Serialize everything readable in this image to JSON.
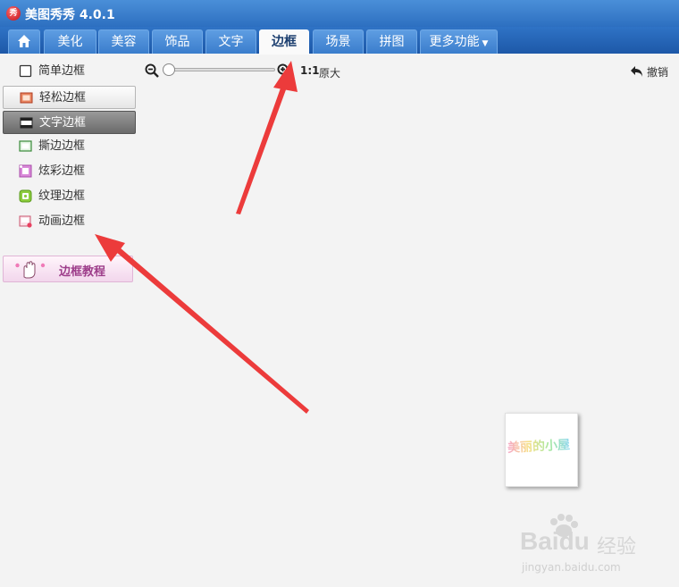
{
  "app": {
    "logo_text": "秀",
    "title": "美图秀秀 4.0.1"
  },
  "tabs": [
    {
      "label": "美化"
    },
    {
      "label": "美容"
    },
    {
      "label": "饰品"
    },
    {
      "label": "文字"
    },
    {
      "label": "边框"
    },
    {
      "label": "场景"
    },
    {
      "label": "拼图"
    },
    {
      "label": "更多功能"
    }
  ],
  "sidebar": {
    "items": [
      {
        "label": "简单边框",
        "icon": "square-outline-icon"
      },
      {
        "label": "轻松边框",
        "icon": "photo-frame-icon"
      },
      {
        "label": "文字边框",
        "icon": "text-frame-icon"
      },
      {
        "label": "撕边边框",
        "icon": "torn-frame-icon"
      },
      {
        "label": "炫彩边框",
        "icon": "colorful-frame-icon"
      },
      {
        "label": "纹理边框",
        "icon": "texture-frame-icon"
      },
      {
        "label": "动画边框",
        "icon": "animation-frame-icon"
      }
    ],
    "tutorial_label": "边框教程"
  },
  "toolbar": {
    "ratio_label": "1:1",
    "original_label": "原大",
    "undo_label": "撤销",
    "zoom_level": 0
  },
  "canvas": {
    "image_text": "美丽的小屋"
  },
  "watermark": {
    "main": "Baidu",
    "cn": "经验",
    "url": "jingyan.baidu.com"
  },
  "colors": {
    "titlebar": "#2d6fc0",
    "annotation_arrow": "#ec3b3b",
    "selected_item": "#6a6a6a"
  }
}
